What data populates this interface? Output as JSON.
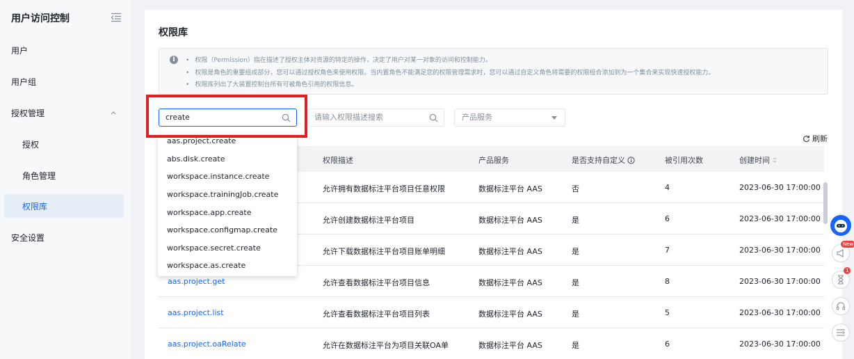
{
  "sidebar": {
    "title": "用户访问控制",
    "items": [
      {
        "label": "用户"
      },
      {
        "label": "用户组"
      },
      {
        "label": "授权管理"
      },
      {
        "label": "授权"
      },
      {
        "label": "角色管理"
      },
      {
        "label": "权限库"
      },
      {
        "label": "安全设置"
      }
    ]
  },
  "main": {
    "title": "权限库",
    "info": [
      "权限（Permission）指在描述了授权主体对资源的特定的操作，决定了用户对某一对象的访问和控制能力。",
      "权限是角色的重要组成部分，您可以通过授权角色来使用权限。当内置角色不能满足您的权限管理需求时，您可以通过自定义角色将需要的权限组合添加到为一个集合来实现快速授权能力。",
      "权限库列出了大装置控制台所有可被角色引用的权限信息。"
    ],
    "search_value": "create",
    "desc_placeholder": "请输入权限描述搜索",
    "product_placeholder": "产品服务",
    "refresh_label": "刷新"
  },
  "table": {
    "headers": [
      "权限描述",
      "产品服务",
      "是否支持自定义",
      "被引用次数",
      "创建时间"
    ],
    "rows": [
      {
        "name": "",
        "desc": "允许拥有数据标注平台项目任意权限",
        "product": "数据标注平台 AAS",
        "custom": "否",
        "count": "4",
        "time": "2023-06-30 17:00:00"
      },
      {
        "name": "",
        "desc": "允许创建数据标注平台项目",
        "product": "数据标注平台 AAS",
        "custom": "是",
        "count": "6",
        "time": "2023-06-30 17:00:00"
      },
      {
        "name": "",
        "desc": "允许下载数据标注平台项目账单明细",
        "product": "数据标注平台 AAS",
        "custom": "是",
        "count": "7",
        "time": "2023-06-30 17:00:00"
      },
      {
        "name": "aas.project.get",
        "desc": "允许查看数据标注平台项目信息",
        "product": "数据标注平台 AAS",
        "custom": "是",
        "count": "8",
        "time": "2023-06-30 17:00:00"
      },
      {
        "name": "aas.project.list",
        "desc": "允许查看数据标注平台项目列表",
        "product": "数据标注平台 AAS",
        "custom": "是",
        "count": "5",
        "time": "2023-06-30 17:00:00"
      },
      {
        "name": "aas.project.oaRelate",
        "desc": "允许在数据标注平台为项目关联OA单",
        "product": "数据标注平台 AAS",
        "custom": "是",
        "count": "6",
        "time": "2023-06-30 17:00:00"
      }
    ]
  },
  "dropdown": [
    "aas.project.create",
    "abs.disk.create",
    "workspace.instance.create",
    "workspace.trainingJob.create",
    "workspace.app.create",
    "workspace.configmap.create",
    "workspace.secret.create",
    "workspace.as.create"
  ],
  "floating": {
    "new_badge": "New",
    "count_badge": "1"
  }
}
